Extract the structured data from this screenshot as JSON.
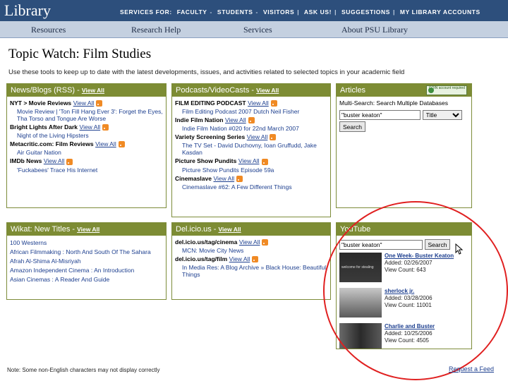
{
  "header": {
    "logo": "Library",
    "links": [
      "SERVICES FOR:",
      "FACULTY",
      "STUDENTS",
      "VISITORS",
      "ASK US!",
      "SUGGESTIONS",
      "MY LIBRARY ACCOUNTS"
    ],
    "separators": [
      "-",
      "-",
      "-",
      "|",
      "|",
      "|"
    ]
  },
  "nav": {
    "items": [
      "Resources",
      "Research Help",
      "Services",
      "About PSU Library"
    ]
  },
  "page": {
    "title": "Topic Watch: Film Studies",
    "intro": "Use these tools to keep up to date with the latest developments, issues, and activities related to selected topics in your academic field"
  },
  "news": {
    "title": "News/Blogs (RSS)",
    "view_all": "View All",
    "rows": [
      {
        "type": "feed",
        "title": "NYT > Movie Reviews",
        "view_all": "View All"
      },
      {
        "type": "item",
        "text": "Movie Review | 'Ton Fill Hang Ever 3': Forget the Eyes, Tha Torso and Tongue Are Worse"
      },
      {
        "type": "feed",
        "title": "Bright Lights After Dark",
        "view_all": "View All"
      },
      {
        "type": "item",
        "text": "Night of the Living Hipsters"
      },
      {
        "type": "feed",
        "title": "Metacritic.com: Film Reviews",
        "view_all": "View All"
      },
      {
        "type": "item",
        "text": "Air Guitar Nation"
      },
      {
        "type": "feed",
        "title": "IMDb News",
        "view_all": "View All"
      },
      {
        "type": "item",
        "text": "'Fuckabees' Trace His Internet"
      }
    ]
  },
  "podcasts": {
    "title": "Podcasts/VideoCasts",
    "view_all": "View All",
    "rows": [
      {
        "type": "feed",
        "title": "FILM EDITING PODCAST",
        "view_all": "View All"
      },
      {
        "type": "item",
        "text": "Film Editing Podcast 2007 Dutch Neil Fisher"
      },
      {
        "type": "feed",
        "title": "Indie Film Nation",
        "view_all": "View All"
      },
      {
        "type": "item",
        "text": "Indie Film Nation #020 for 22nd March 2007"
      },
      {
        "type": "feed",
        "title": "Variety Screening Series",
        "view_all": "View All"
      },
      {
        "type": "item",
        "text": "The TV Set - David Duchovny, Ioan Gruffudd, Jake Kasdan"
      },
      {
        "type": "feed",
        "title": "Picture Show Pundits",
        "view_all": "View All"
      },
      {
        "type": "item",
        "text": "Picture Show Pundits Episode 59a"
      },
      {
        "type": "feed",
        "title": "Cinemaslave",
        "view_all": "View All"
      },
      {
        "type": "item",
        "text": "Cinemaslave #62: A Few Different Things"
      }
    ]
  },
  "articles": {
    "title": "Articles",
    "badge": "COIN account required",
    "subtitle": "Multi-Search: Search Multiple Databases",
    "search_value": "\"buster keaton\"",
    "select_value": "Title",
    "button": "Search"
  },
  "wikat": {
    "title": "Wikat: New Titles",
    "view_all": "View All",
    "items": [
      "100 Westerns",
      "African Filmmaking : North And South Of The Sahara",
      "Afrah Al-Shima Al-Misriyah",
      "Amazon Independent Cinema : An Introduction",
      "Asian Cinemas : A Reader And Guide"
    ]
  },
  "delicious": {
    "title": "Del.icio.us",
    "view_all": "View All",
    "rows": [
      {
        "type": "feed",
        "title": "del.icio.us/tag/cinema",
        "view_all": "View All"
      },
      {
        "type": "item",
        "text": "MCN: Movie City News"
      },
      {
        "type": "feed",
        "title": "del.icio.us/tag/film",
        "view_all": "View All"
      },
      {
        "type": "item",
        "text": "In Media Res: A Blog Archive » Black House: Beautiful Things"
      }
    ]
  },
  "youtube": {
    "title": "YouTube",
    "search_value": "\"buster keaton\"",
    "button": "Search",
    "videos": [
      {
        "title": "One Week- Buster Keaton",
        "added": "Added: 02/26/2007",
        "views": "View Count: 643",
        "thumb_text": "welcome for stealing"
      },
      {
        "title": "sherlock jr.",
        "added": "Added: 03/28/2006",
        "views": "View Count: 11001",
        "thumb_text": ""
      },
      {
        "title": "Charlie and Buster",
        "added": "Added: 10/25/2006",
        "views": "View Count: 4505",
        "thumb_text": ""
      }
    ]
  },
  "footer": {
    "note": "Note: Some non-English characters may not display correctly",
    "request": "Request a Feed"
  },
  "colors": {
    "topbar": "#2d4f7c",
    "navbar": "#c4d0e0",
    "panel_head": "#7d8c34",
    "link": "#1d3f8f",
    "annotation": "#e02020"
  }
}
